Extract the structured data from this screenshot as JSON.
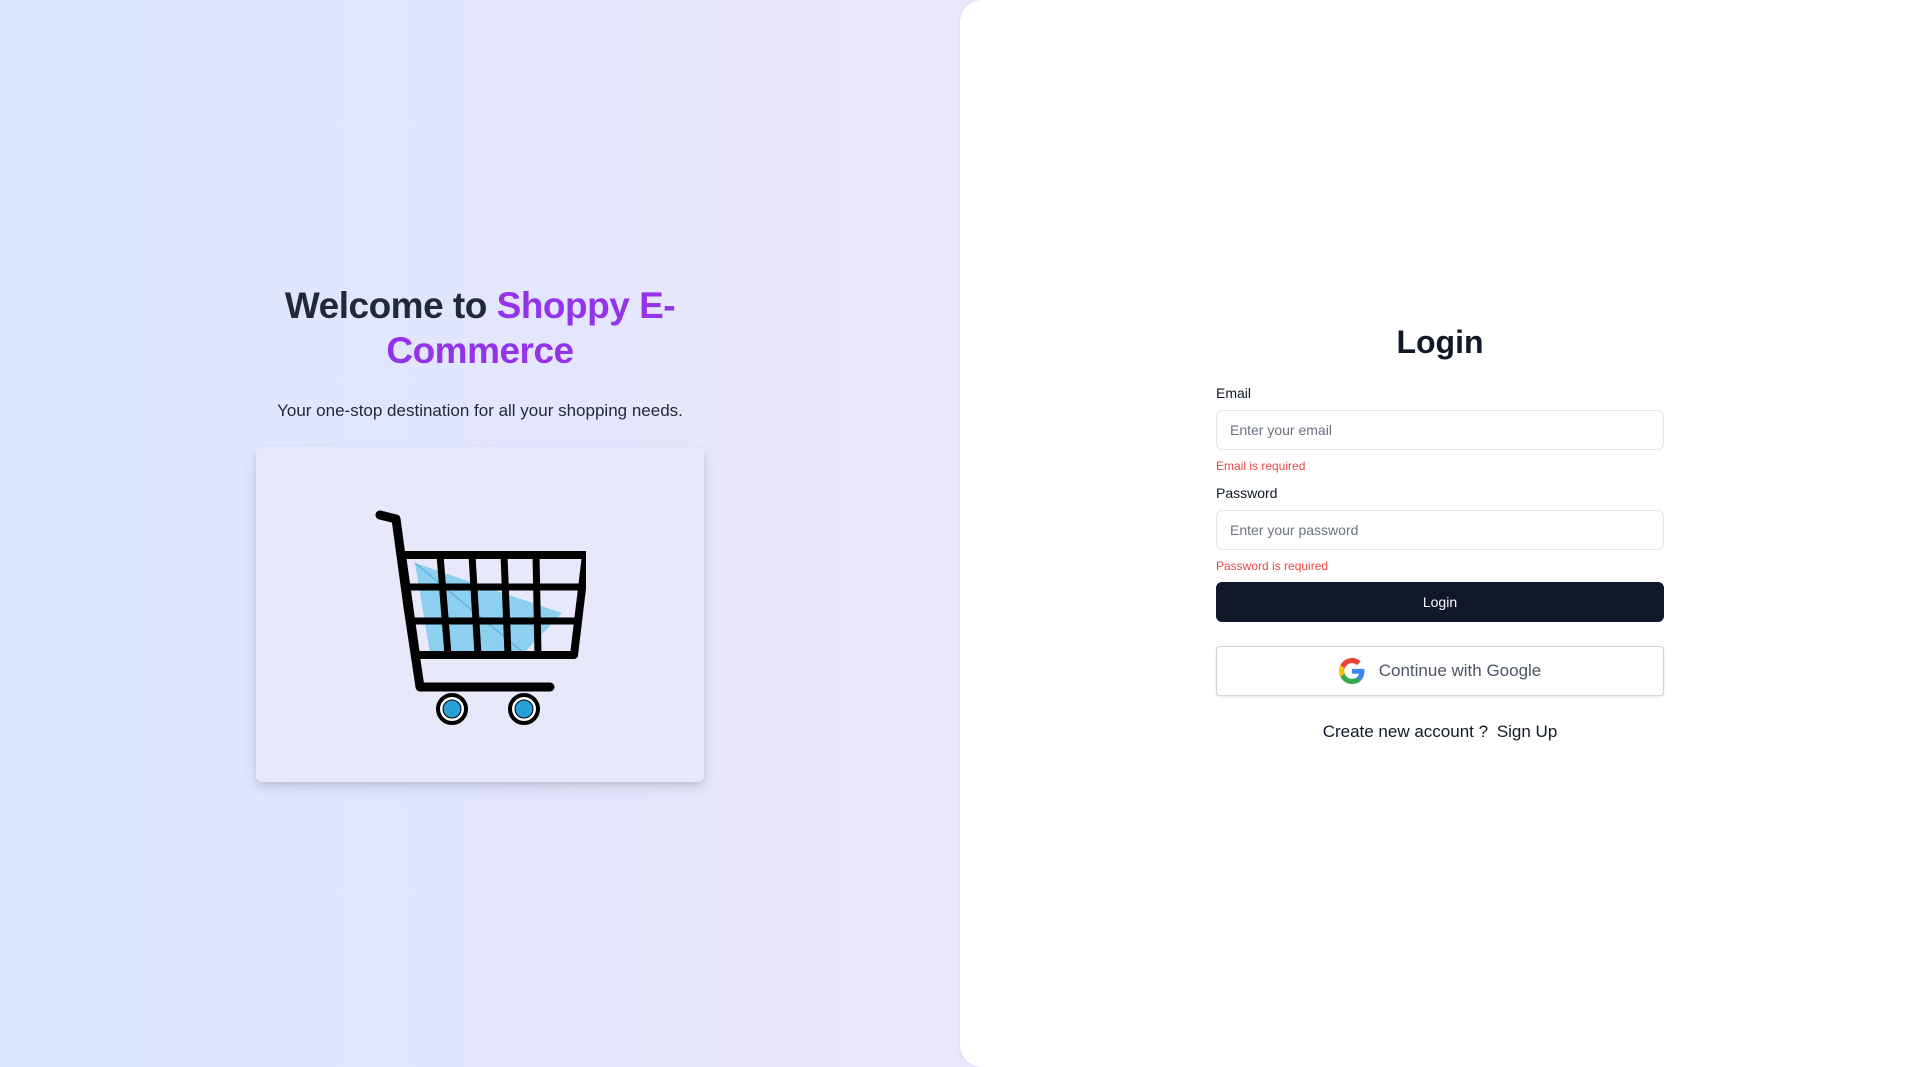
{
  "hero": {
    "welcome_prefix": "Welcome to ",
    "brand_name": "Shoppy E-Commerce",
    "tagline": "Your one-stop destination for all your shopping needs.",
    "image_icon": "shopping-cart-icon"
  },
  "login": {
    "title": "Login",
    "email_label": "Email",
    "email_placeholder": "Enter your email",
    "email_error": "Email is required",
    "password_label": "Password",
    "password_placeholder": "Enter your password",
    "password_error": "Password is required",
    "submit_label": "Login",
    "google_label": "Continue with Google",
    "google_icon": "google-icon",
    "signup_prompt": "Create new account ?",
    "signup_link": "Sign Up"
  },
  "colors": {
    "brand": "#9333ea",
    "primary_button": "#0f172a",
    "error": "#ef4444"
  }
}
